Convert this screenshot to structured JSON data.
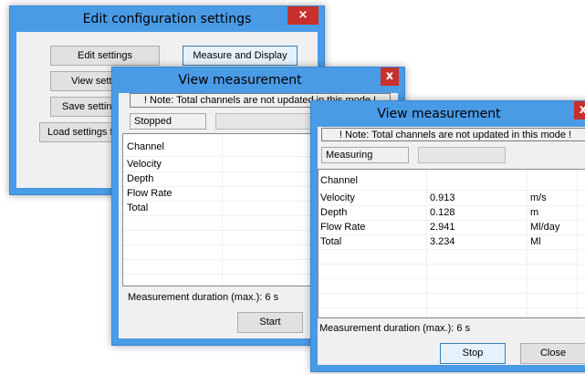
{
  "config_window": {
    "title": "Edit configuration settings",
    "close_label": "×",
    "buttons": {
      "edit_settings": "Edit settings",
      "measure_display": "Measure and Display",
      "view_settings": "View settin",
      "save_settings": "Save settings",
      "load_settings": "Load settings fi"
    }
  },
  "view_window_back": {
    "title": "View measurement",
    "close_label": "x",
    "note": "! Note: Total channels are not updated in this mode !",
    "status": "Stopped",
    "table_header": "Channel",
    "rows": [
      {
        "channel": "Velocity"
      },
      {
        "channel": "Depth"
      },
      {
        "channel": "Flow Rate"
      },
      {
        "channel": "Total"
      }
    ],
    "duration_label": "Measurement duration (max.): 6 s",
    "start_label": "Start"
  },
  "view_window_front": {
    "title": "View measurement",
    "close_label": "x",
    "note": "! Note: Total channels are not updated in this mode !",
    "status": "Measuring",
    "table_header": "Channel",
    "rows": [
      {
        "channel": "Velocity",
        "value": "0.913",
        "unit": "m/s"
      },
      {
        "channel": "Depth",
        "value": "0.128",
        "unit": "m"
      },
      {
        "channel": "Flow Rate",
        "value": "2.941",
        "unit": "Ml/day"
      },
      {
        "channel": "Total",
        "value": "3.234",
        "unit": "Ml"
      }
    ],
    "duration_label": "Measurement duration (max.): 6 s",
    "stop_label": "Stop",
    "close_button_label": "Close"
  }
}
